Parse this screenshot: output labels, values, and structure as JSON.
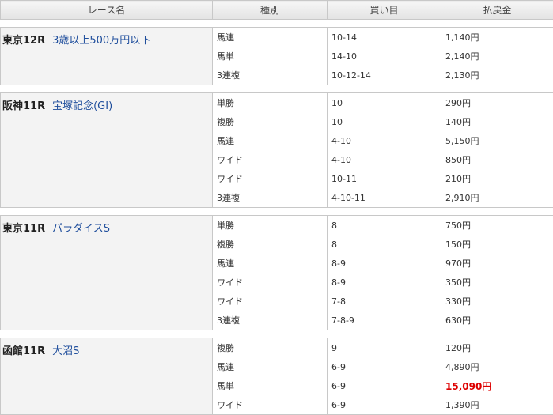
{
  "headers": [
    "レース名",
    "種別",
    "買い目",
    "払戻金"
  ],
  "high_payout_color": "#dd0000",
  "races": [
    {
      "venue": "東京12R",
      "name": "3歳以上500万円以下",
      "rows": [
        {
          "type": "馬連",
          "combo": "10-14",
          "payout": "1,140円"
        },
        {
          "type": "馬単",
          "combo": "14-10",
          "payout": "2,140円"
        },
        {
          "type": "3連複",
          "combo": "10-12-14",
          "payout": "2,130円"
        }
      ]
    },
    {
      "venue": "阪神11R",
      "name": "宝塚記念(GI)",
      "rows": [
        {
          "type": "単勝",
          "combo": "10",
          "payout": "290円"
        },
        {
          "type": "複勝",
          "combo": "10",
          "payout": "140円"
        },
        {
          "type": "馬連",
          "combo": "4-10",
          "payout": "5,150円"
        },
        {
          "type": "ワイド",
          "combo": "4-10",
          "payout": "850円"
        },
        {
          "type": "ワイド",
          "combo": "10-11",
          "payout": "210円"
        },
        {
          "type": "3連複",
          "combo": "4-10-11",
          "payout": "2,910円"
        }
      ]
    },
    {
      "venue": "東京11R",
      "name": "パラダイスS",
      "rows": [
        {
          "type": "単勝",
          "combo": "8",
          "payout": "750円"
        },
        {
          "type": "複勝",
          "combo": "8",
          "payout": "150円"
        },
        {
          "type": "馬連",
          "combo": "8-9",
          "payout": "970円"
        },
        {
          "type": "ワイド",
          "combo": "8-9",
          "payout": "350円"
        },
        {
          "type": "ワイド",
          "combo": "7-8",
          "payout": "330円"
        },
        {
          "type": "3連複",
          "combo": "7-8-9",
          "payout": "630円"
        }
      ]
    },
    {
      "venue": "函館11R",
      "name": "大沼S",
      "rows": [
        {
          "type": "複勝",
          "combo": "9",
          "payout": "120円"
        },
        {
          "type": "馬連",
          "combo": "6-9",
          "payout": "4,890円"
        },
        {
          "type": "馬単",
          "combo": "6-9",
          "payout": "15,090円",
          "highlight": true
        },
        {
          "type": "ワイド",
          "combo": "6-9",
          "payout": "1,390円"
        }
      ]
    }
  ]
}
